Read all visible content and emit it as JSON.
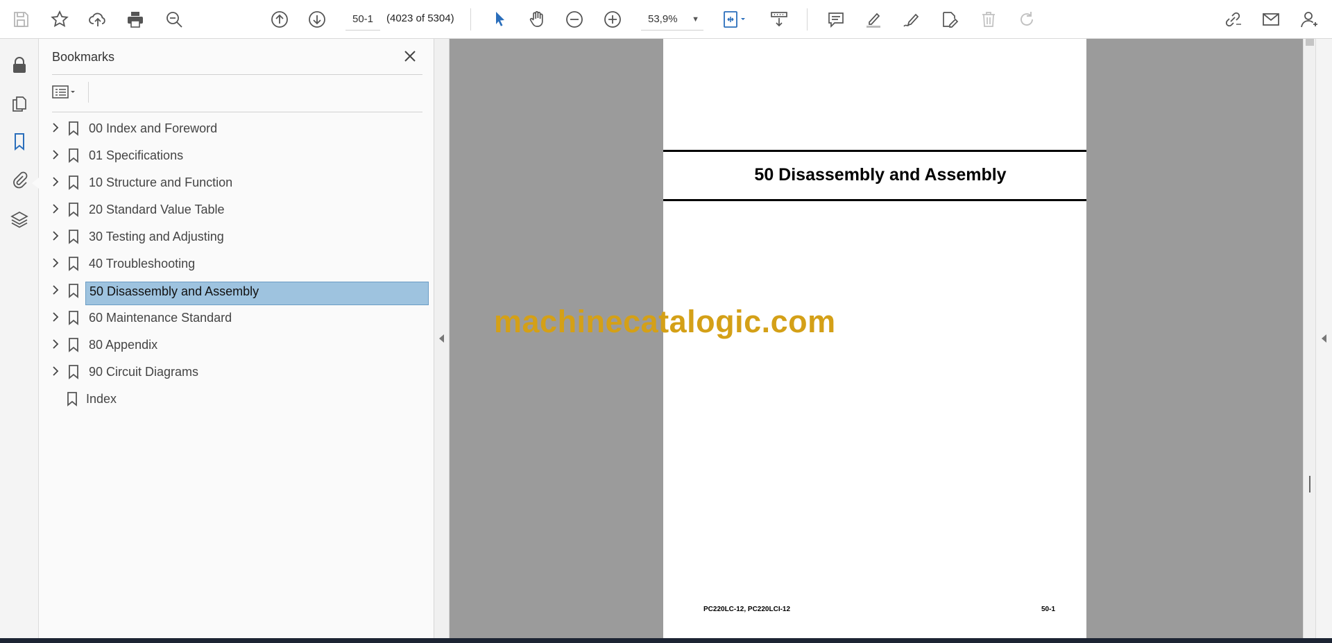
{
  "toolbar": {
    "current_page": "50-1",
    "page_count": "(4023 of 5304)",
    "zoom": "53,9%"
  },
  "bookmarks_panel": {
    "title": "Bookmarks",
    "items": [
      {
        "label": "00 Index and Foreword",
        "expandable": true,
        "selected": false
      },
      {
        "label": "01 Specifications",
        "expandable": true,
        "selected": false
      },
      {
        "label": "10 Structure and Function",
        "expandable": true,
        "selected": false
      },
      {
        "label": "20 Standard Value Table",
        "expandable": true,
        "selected": false
      },
      {
        "label": "30 Testing and Adjusting",
        "expandable": true,
        "selected": false
      },
      {
        "label": "40 Troubleshooting",
        "expandable": true,
        "selected": false
      },
      {
        "label": "50 Disassembly and Assembly",
        "expandable": true,
        "selected": true
      },
      {
        "label": "60 Maintenance Standard",
        "expandable": true,
        "selected": false
      },
      {
        "label": "80 Appendix",
        "expandable": true,
        "selected": false
      },
      {
        "label": "90 Circuit Diagrams",
        "expandable": true,
        "selected": false
      },
      {
        "label": "Index",
        "expandable": false,
        "selected": false
      }
    ]
  },
  "document": {
    "chapter_title": "50 Disassembly and Assembly",
    "footer_model": "PC220LC-12, PC220LCI-12",
    "footer_page": "50-1",
    "watermark": "machinecatalogic.com"
  },
  "colors": {
    "accent_blue": "#2a6ebb",
    "selection": "#9ec3df",
    "watermark": "#d4a017",
    "doc_background": "#9b9b9b"
  }
}
